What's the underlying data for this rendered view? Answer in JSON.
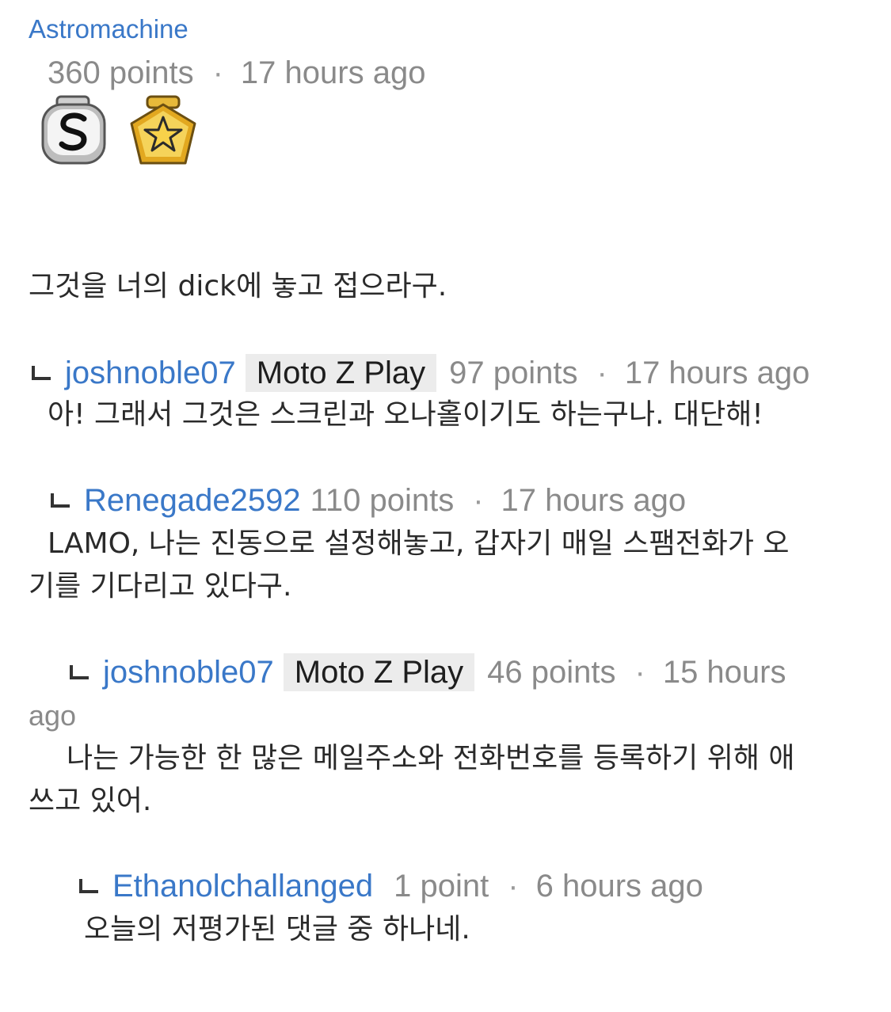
{
  "root_comment": {
    "author": "Astromachine",
    "points": "360 points",
    "separator": "·",
    "time": "17 hours ago",
    "badges": [
      "s-badge-icon",
      "star-badge-icon"
    ],
    "body": "그것을 너의 dick에 놓고 접으라구."
  },
  "replies": [
    {
      "author": "joshnoble07",
      "device": "Moto Z Play",
      "points": "97 points",
      "separator": "·",
      "time": "17 hours ago",
      "body": "아! 그래서 그것은 스크린과 오나홀이기도 하는구나. 대단해!"
    },
    {
      "author": "Renegade2592",
      "points": "110 points",
      "separator": "·",
      "time": "17 hours ago",
      "body_line1": "LAMO, 나는 진동으로 설정해놓고, 갑자기 매일 스팸전화가 오",
      "body_line2": "기를 기다리고 있다구."
    },
    {
      "author": "joshnoble07",
      "device": "Moto Z Play",
      "points": "46 points",
      "separator": "·",
      "time_line1": "15 hours",
      "time_line2": "ago",
      "body_line1": "나는 가능한 한 많은 메일주소와 전화번호를 등록하기 위해 애",
      "body_line2": "쓰고 있어."
    },
    {
      "author": "Ethanolchallanged",
      "points": "1 point",
      "separator": "·",
      "time": "6 hours ago",
      "body": "오늘의 저평가된 댓글 중 하나네."
    }
  ]
}
